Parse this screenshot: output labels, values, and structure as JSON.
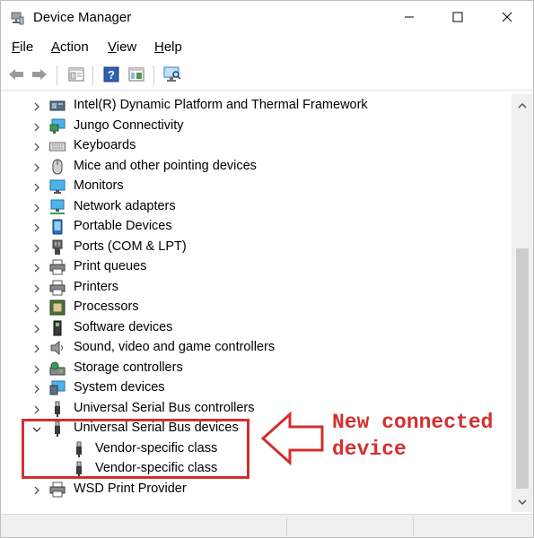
{
  "window": {
    "title": "Device Manager"
  },
  "window_controls": {
    "minimize_icon": "minimize-icon",
    "maximize_icon": "maximize-icon",
    "close_icon": "close-icon"
  },
  "menu": [
    {
      "label": "File"
    },
    {
      "label": "Action"
    },
    {
      "label": "View"
    },
    {
      "label": "Help"
    }
  ],
  "toolbar": {
    "buttons": [
      "back-arrow-icon",
      "forward-arrow-icon",
      "properties-icon",
      "help-icon",
      "console-tree-icon",
      "scan-hardware-icon"
    ]
  },
  "tree": {
    "items": [
      {
        "label": "Intel(R) Dynamic Platform and Thermal Framework",
        "icon": "chip-icon",
        "expanded": false
      },
      {
        "label": "Jungo Connectivity",
        "icon": "monitor-network-icon",
        "expanded": false
      },
      {
        "label": "Keyboards",
        "icon": "keyboard-icon",
        "expanded": false
      },
      {
        "label": "Mice and other pointing devices",
        "icon": "mouse-icon",
        "expanded": false
      },
      {
        "label": "Monitors",
        "icon": "monitor-icon",
        "expanded": false
      },
      {
        "label": "Network adapters",
        "icon": "network-adapter-icon",
        "expanded": false
      },
      {
        "label": "Portable Devices",
        "icon": "portable-device-icon",
        "expanded": false
      },
      {
        "label": "Ports (COM & LPT)",
        "icon": "port-icon",
        "expanded": false
      },
      {
        "label": "Print queues",
        "icon": "printer-icon",
        "expanded": false
      },
      {
        "label": "Printers",
        "icon": "printer-icon",
        "expanded": false
      },
      {
        "label": "Processors",
        "icon": "processor-icon",
        "expanded": false
      },
      {
        "label": "Software devices",
        "icon": "software-device-icon",
        "expanded": false
      },
      {
        "label": "Sound, video and game controllers",
        "icon": "speaker-icon",
        "expanded": false
      },
      {
        "label": "Storage controllers",
        "icon": "storage-controller-icon",
        "expanded": false
      },
      {
        "label": "System devices",
        "icon": "system-device-icon",
        "expanded": false
      },
      {
        "label": "Universal Serial Bus controllers",
        "icon": "usb-icon",
        "expanded": false
      },
      {
        "label": "Universal Serial Bus devices",
        "icon": "usb-icon",
        "expanded": true
      },
      {
        "label": "Vendor-specific class",
        "icon": "usb-icon",
        "child": true
      },
      {
        "label": "Vendor-specific class",
        "icon": "usb-icon",
        "child": true
      },
      {
        "label": "WSD Print Provider",
        "icon": "printer-icon",
        "expanded": false
      }
    ]
  },
  "annotation": {
    "line1": "New connected",
    "line2": "device",
    "color": "#d32f2f"
  }
}
